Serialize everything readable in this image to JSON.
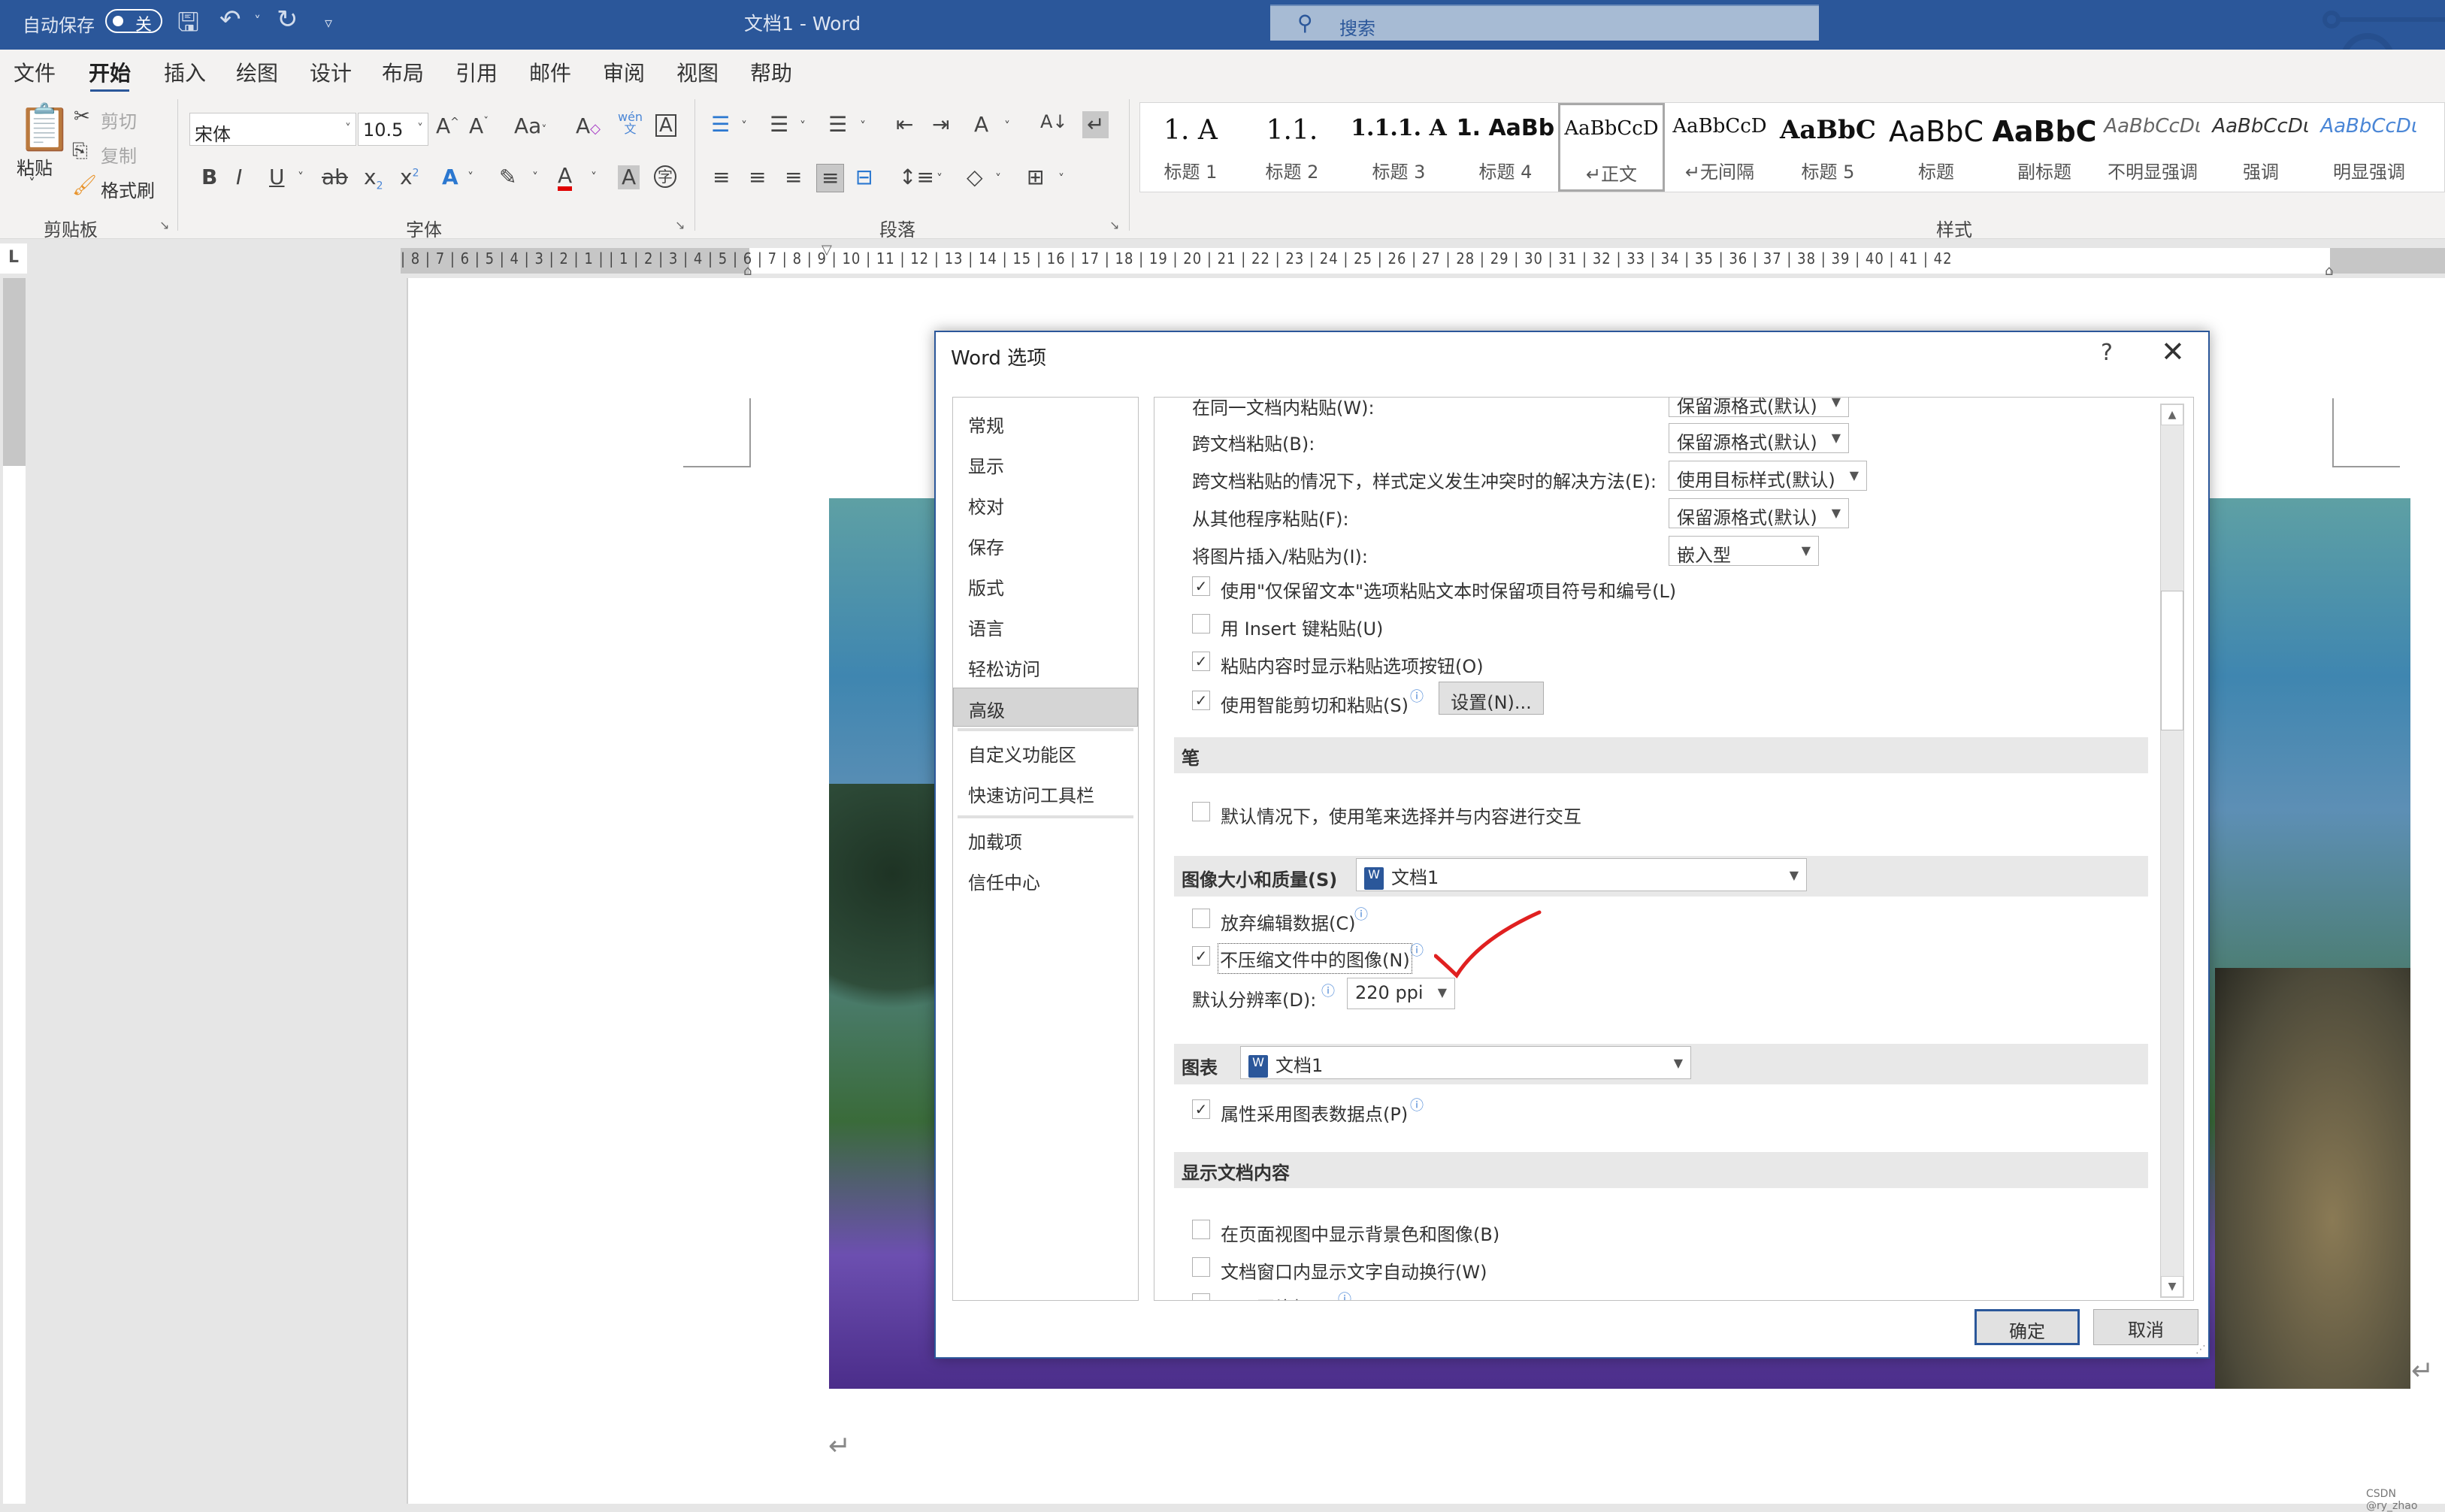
{
  "titlebar": {
    "autosave_label": "自动保存",
    "autosave_state": "关",
    "document_title": "文档1 - Word",
    "search_placeholder": "搜索"
  },
  "tabs": [
    "文件",
    "开始",
    "插入",
    "绘图",
    "设计",
    "布局",
    "引用",
    "邮件",
    "审阅",
    "视图",
    "帮助"
  ],
  "active_tab": "开始",
  "ribbon": {
    "clipboard": {
      "paste": "粘贴",
      "cut": "剪切",
      "copy": "复制",
      "format_painter": "格式刷",
      "group": "剪贴板"
    },
    "font": {
      "font_name": "宋体",
      "font_size": "10.5",
      "group": "字体",
      "bold": "B",
      "italic": "I",
      "underline": "U",
      "strike": "ab",
      "subscript": "x₂",
      "superscript": "x²",
      "grow": "A^",
      "shrink": "Aˇ",
      "case": "Aa",
      "clear": "A",
      "phonetic": "wén",
      "border": "A",
      "effects": "A",
      "highlight": "✎",
      "color": "A",
      "shading": "A",
      "enclose": "字"
    },
    "paragraph": {
      "group": "段落"
    },
    "styles": {
      "group": "样式",
      "items": [
        {
          "preview": "1.  A",
          "name": "标题 1"
        },
        {
          "preview": "1.1.",
          "name": "标题 2"
        },
        {
          "preview": "1.1.1. A",
          "name": "标题 3"
        },
        {
          "preview": "1. AaBb",
          "name": "标题 4"
        },
        {
          "preview": "AaBbCcD",
          "name": "↵正文",
          "selected": true
        },
        {
          "preview": "AaBbCcD",
          "name": "↵无间隔"
        },
        {
          "preview": "AaBbC",
          "name": "标题 5"
        },
        {
          "preview": "AaBbC",
          "name": "标题"
        },
        {
          "preview": "AaBbC",
          "name": "副标题"
        },
        {
          "preview": "AaBbCcDι",
          "name": "不明显强调"
        },
        {
          "preview": "AaBbCcDι",
          "name": "强调"
        },
        {
          "preview": "AaBbCcDι",
          "name": "明显强调"
        }
      ]
    }
  },
  "ruler": {
    "numbers": "| 8 | 7 | 6 | 5 | 4 | 3 | 2 | 1 |   | 1 | 2 | 3 | 4 | 5 | 6 | 7 | 8 | 9 | 10 | 11 | 12 | 13 | 14 | 15 | 16 | 17 | 18 | 19 | 20 | 21 | 22 | 23 | 24 | 25 | 26 | 27 | 28 | 29 | 30 | 31 | 32 | 33 | 34 | 35 | 36 | 37 | 38 | 39 | 40 | 41 | 42",
    "tab_selector": "L"
  },
  "document": {
    "paragraph_mark": "↵",
    "watermark": "CSDN @ry_zhao"
  },
  "dialog": {
    "title": "Word 选项",
    "help": "?",
    "close": "✕",
    "nav": [
      {
        "label": "常规"
      },
      {
        "label": "显示"
      },
      {
        "label": "校对"
      },
      {
        "label": "保存"
      },
      {
        "label": "版式"
      },
      {
        "label": "语言"
      },
      {
        "label": "轻松访问"
      },
      {
        "label": "高级",
        "active": true
      },
      {
        "label": "自定义功能区"
      },
      {
        "label": "快速访问工具栏"
      },
      {
        "label": "加载项"
      },
      {
        "label": "信任中心"
      }
    ],
    "paste_options": [
      {
        "label": "在同一文档内粘贴(W):",
        "value": "保留源格式(默认)"
      },
      {
        "label": "跨文档粘贴(B):",
        "value": "保留源格式(默认)"
      },
      {
        "label": "跨文档粘贴的情况下，样式定义发生冲突时的解决方法(E):",
        "value": "使用目标样式(默认)"
      },
      {
        "label": "从其他程序粘贴(F):",
        "value": "保留源格式(默认)"
      },
      {
        "label": "将图片插入/粘贴为(I):",
        "value": "嵌入型"
      }
    ],
    "paste_checks": [
      {
        "label": "使用\"仅保留文本\"选项粘贴文本时保留项目符号和编号(L)",
        "checked": true
      },
      {
        "label": "用 Insert 键粘贴(U)",
        "checked": false
      },
      {
        "label": "粘贴内容时显示粘贴选项按钮(O)",
        "checked": true
      },
      {
        "label": "使用智能剪切和粘贴(S)",
        "checked": true
      }
    ],
    "settings_button": "设置(N)...",
    "pen_section": {
      "title": "笔",
      "checks": [
        {
          "label": "默认情况下，使用笔来选择并与内容进行交互",
          "checked": false
        }
      ]
    },
    "image_section": {
      "title": "图像大小和质量(S)",
      "document": "文档1",
      "checks": [
        {
          "label": "放弃编辑数据(C)",
          "checked": false
        },
        {
          "label": "不压缩文件中的图像(N)",
          "checked": true
        }
      ],
      "resolution_label": "默认分辨率(D):",
      "resolution_value": "220 ppi"
    },
    "chart_section": {
      "title": "图表",
      "document": "文档1",
      "checks": [
        {
          "label": "属性采用图表数据点(P)",
          "checked": true
        }
      ]
    },
    "display_section": {
      "title": "显示文档内容",
      "checks": [
        {
          "label": "在页面视图中显示背景色和图像(B)",
          "checked": false
        },
        {
          "label": "文档窗口内显示文字自动换行(W)",
          "checked": false
        },
        {
          "label": "显示图片框(P)",
          "checked": false
        }
      ]
    },
    "ok": "确定",
    "cancel": "取消"
  },
  "colors": {
    "brand": "#2b579a",
    "annotation": "#e02020"
  }
}
